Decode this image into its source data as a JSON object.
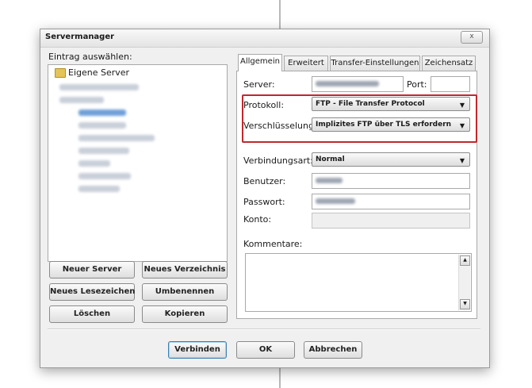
{
  "dialog": {
    "title": "Servermanager",
    "close_glyph": "x",
    "tree_label": "Eintrag auswählen:",
    "tree_root": "Eigene Server",
    "buttons": {
      "new_server": "Neuer Server",
      "new_folder": "Neues Verzeichnis",
      "new_bookmark": "Neues Lesezeichen",
      "rename": "Umbenennen",
      "delete": "Löschen",
      "copy": "Kopieren"
    },
    "footer": {
      "connect": "Verbinden",
      "ok": "OK",
      "cancel": "Abbrechen"
    }
  },
  "tabs": [
    "Allgemein",
    "Erweitert",
    "Transfer-Einstellungen",
    "Zeichensatz"
  ],
  "general": {
    "server_label": "Server:",
    "port_label": "Port:",
    "protocol_label": "Protokoll:",
    "protocol_value": "FTP - File Transfer Protocol",
    "encryption_label": "Verschlüsselung:",
    "encryption_value": "Implizites FTP über TLS erfordern",
    "logon_label": "Verbindungsart:",
    "logon_value": "Normal",
    "user_label": "Benutzer:",
    "password_label": "Passwort:",
    "account_label": "Konto:",
    "comments_label": "Kommentare:"
  },
  "icons": {
    "dropdown": "chevron-down-icon",
    "folder": "folder-icon"
  },
  "colors": {
    "highlight_border": "#c0282d",
    "selected_item": "#6f9fd8"
  }
}
